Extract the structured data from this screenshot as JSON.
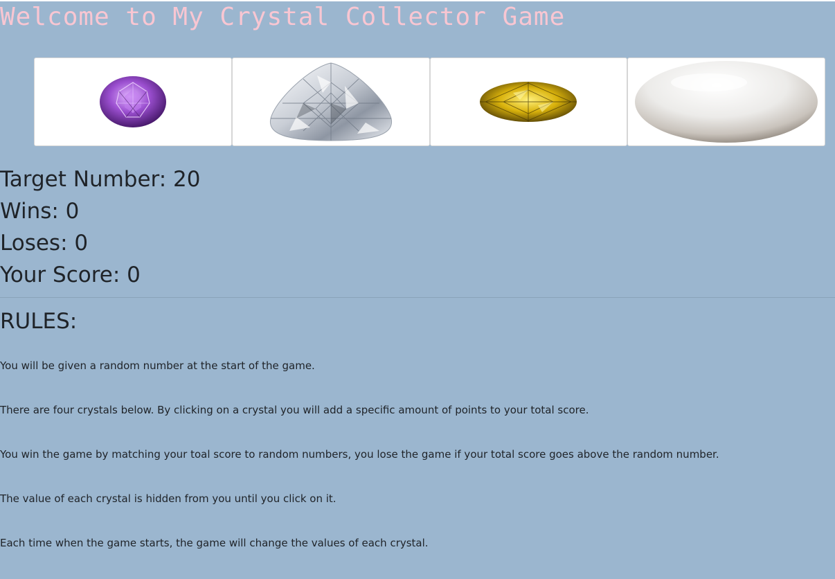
{
  "page": {
    "title": "Welcome to My Crystal Collector Game",
    "background": "#9bb6cf",
    "title_color": "#f8c6d2"
  },
  "crystals": [
    {
      "name": "amethyst",
      "icon": "purple-oval-gem-icon",
      "color": "#9b4fd0"
    },
    {
      "name": "diamond",
      "icon": "clear-pear-diamond-icon",
      "color": "#e6e9ee"
    },
    {
      "name": "citrine",
      "icon": "yellow-oval-gem-icon",
      "color": "#c9a60c"
    },
    {
      "name": "pearl",
      "icon": "white-pearl-icon",
      "color": "#ece8e4"
    }
  ],
  "stats": {
    "target": "Target Number: 20",
    "wins": "Wins: 0",
    "losses": "Loses: 0",
    "score": "Your Score: 0"
  },
  "rules": {
    "heading": "RULES:",
    "items": [
      "You will be given a random number at the start of the game.",
      "There are four crystals below. By clicking on a crystal you will add a specific amount of points to your total score.",
      "You win the game by matching your toal score to random numbers, you lose the game if your total score goes above the random number.",
      "The value of each crystal is hidden from you until you click on it.",
      "Each time when the game starts, the game will change the values of each crystal."
    ]
  }
}
